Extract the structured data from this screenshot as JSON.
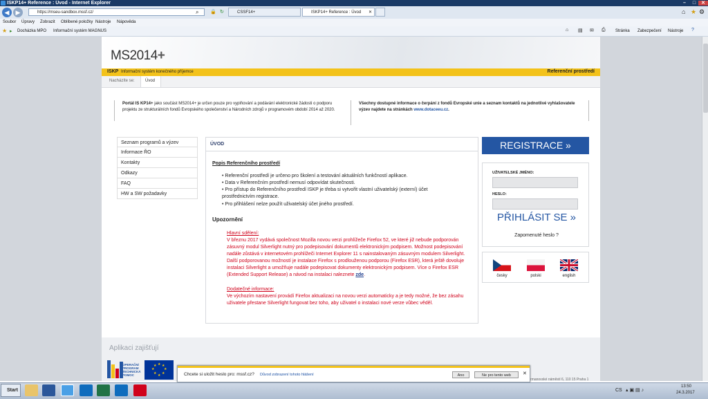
{
  "window": {
    "title": "ISKP14+ Reference : Úvod - Internet Explorer"
  },
  "browser": {
    "url": "https://mseu-sandbox.mssf.cz/",
    "tabs": [
      {
        "label": "CSSF14+"
      },
      {
        "label": "ISKP14+ Reference : Úvod"
      }
    ],
    "menu": [
      "Soubor",
      "Úpravy",
      "Zobrazit",
      "Oblíbené položky",
      "Nástroje",
      "Nápověda"
    ],
    "favorites": [
      "Docházka MPO",
      "Informační systém MAGNUS"
    ],
    "commands": [
      "Stránka",
      "Zabezpečení",
      "Nástroje"
    ]
  },
  "site": {
    "logo_main": "MS2014",
    "logo_plus": "+",
    "system_code": "ISKP",
    "system_name": "Informační systém konečného příjemce",
    "environment": "Referenční prostředí",
    "breadcrumb_label": "Nacházíte se:",
    "breadcrumb_current": "Úvod",
    "info_left_bold": "Portál IS KP14+",
    "info_left_text": " jako součást MS2014+ je určen pouze pro vyplňování a podávání elektronické žádosti o podporu projektu ze strukturálních fondů Evropského společenství a Národních zdrojů v programovém období 2014 až 2020.",
    "info_right_text": "Všechny dostupné informace o čerpání z fondů Evropské unie a seznam kontaktů na jednotlivé vyhlašovatele výzev najdete na stránkách ",
    "info_right_link": "www.dotaceeu.cz",
    "info_right_end": "."
  },
  "left_menu": [
    "Seznam programů a výzev",
    "Informace ŘO",
    "Kontakty",
    "Odkazy",
    "FAQ",
    "HW a SW požadavky"
  ],
  "content": {
    "heading": "ÚVOD",
    "section1": "Popis Referenčního prostředí",
    "bullets": [
      "Referenční prostředí je určeno pro školení a testování aktuálních funkčností aplikace.",
      "Data v Referenčním prostředí nemusí odpovídat skutečnosti.",
      "Pro přístup do Referenčního prostředí ISKP je třeba si vytvořit vlastní uživatelský (externí) účet prostřednictvím registrace.",
      "Pro přihlášení nelze použít uživatelský účet jiného prostředí."
    ],
    "section2": "Upozornění",
    "notice1_title": "Hlavní sdělení:",
    "notice1_text": "V březnu 2017 vydává společnost Mozilla novou verzi prohlížeče Firefox 52, ve které již nebude podporován zásuvný modul Silverlight nutný pro podepisování dokumentů elektronickým podpisem. Možnost podepisování nadále zůstává v internetovém prohlížeči Internet Explorer 11 s nainstalovaným zásuvným modulem Silverlight. Další podporovanou možností je instalace Firefox s prodlouženou podporou (Firefox ESR), která ještě dovoluje instalaci Silverlight a umožňuje nadále podepisovat dokumenty elektronickým podpisem. Více o Firefox ESR (Extended Support Release) a návod na instalaci naleznete ",
    "notice1_link": "zde",
    "notice1_end": ".",
    "notice2_title": "Dodatečné informace:",
    "notice2_text": "Ve výchozím nastavení provádí Firefox aktualizaci na novou verzi automaticky a je tedy možné, že bez zásahu uživatele přestane Silverlight fungovat bez toho, aby uživatel o instalaci nové verze vůbec věděl."
  },
  "login": {
    "register_label": "REGISTRACE »",
    "username_label": "UŽIVATELSKÉ JMÉNO:",
    "password_label": "HESLO:",
    "login_label": "PŘIHLÁSIT SE »",
    "forgot_label": "Zapomenuté heslo ?"
  },
  "languages": [
    {
      "label": "česky"
    },
    {
      "label": "polski"
    },
    {
      "label": "english"
    }
  ],
  "footer": {
    "heading": "Aplikaci zajišťují",
    "logo_text": [
      "OPERAČNÍ",
      "PROGRAM",
      "TECHNICKÁ",
      "POMOC"
    ],
    "address_fragment": "rmanovské náměstí 6, 110 15 Praha 1"
  },
  "password_prompt": {
    "question": "Chcete si uložit heslo pro: mssf.cz?",
    "reason_link": "Důvod zobrazení tohoto hlášení",
    "yes_label": "Ano",
    "no_label": "Ne pro tento web"
  },
  "taskbar": {
    "start_label": "Start",
    "lang": "CS",
    "time": "13:50",
    "date": "24.3.2017"
  }
}
